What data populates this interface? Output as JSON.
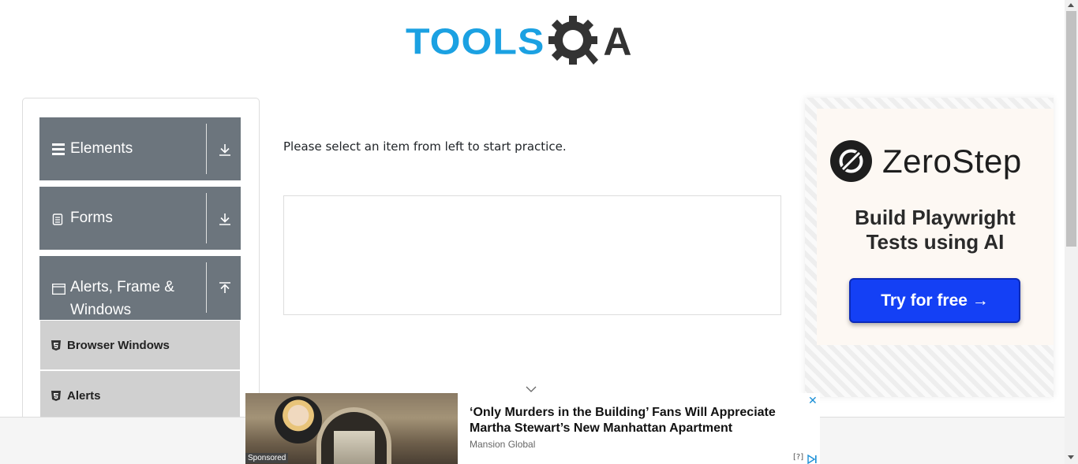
{
  "header": {
    "logo_text_tools": "TOOLS",
    "logo_text_a": "A",
    "logo_icon": "gear-magnifier-icon",
    "colors": {
      "tools": "#1ba1e2",
      "qa": "#333333"
    }
  },
  "sidebar": {
    "groups": [
      {
        "label": "Elements",
        "icon": "hamburger-icon",
        "arrow": "download-arrow-icon"
      },
      {
        "label": "Forms",
        "icon": "document-icon",
        "arrow": "download-arrow-icon"
      },
      {
        "label": "Alerts, Frame &",
        "label_line2": "Windows",
        "icon": "window-icon",
        "arrow": "upload-arrow-icon"
      }
    ],
    "items": [
      {
        "label": "Browser Windows",
        "icon": "html5-icon"
      },
      {
        "label": "Alerts",
        "icon": "html5-icon"
      }
    ],
    "colors": {
      "group_bg": "#6c757d",
      "item_bg": "#d0d0d0"
    }
  },
  "main": {
    "instruction": "Please select an item from left to start practice."
  },
  "ad_right": {
    "brand": "ZeroStep",
    "tagline_line1": "Build Playwright",
    "tagline_line2": "Tests using AI",
    "button": "Try for free →",
    "colors": {
      "button": "#1440f5"
    }
  },
  "ad_bottom": {
    "headline": "‘Only Murders in the Building’ Fans Will Appreciate Martha Stewart’s New Manhattan Apartment",
    "source": "Mansion Global",
    "sponsored": "Sponsored",
    "close": "✕",
    "help": "[?]"
  }
}
